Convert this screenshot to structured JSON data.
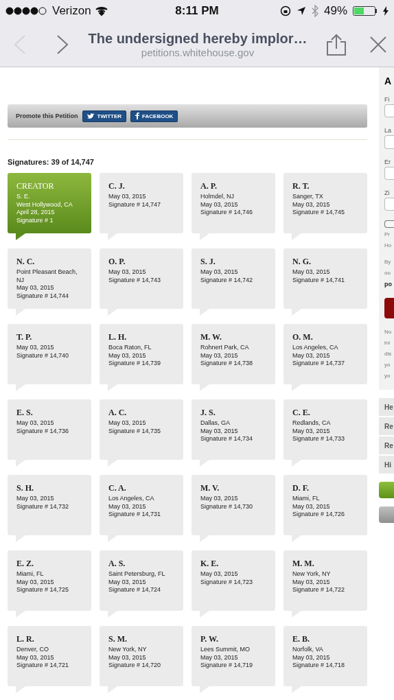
{
  "status_bar": {
    "carrier": "Verizon",
    "time": "8:11 PM",
    "battery": "49%"
  },
  "browser": {
    "title": "The undersigned hereby implor…",
    "url": "petitions.whitehouse.gov"
  },
  "promote": {
    "label": "Promote this Petition",
    "buttons": [
      "TWITTER",
      "FACEBOOK"
    ]
  },
  "signatures_count": "Signatures: 39 of 14,747",
  "cards": [
    {
      "kind": "creator",
      "label": "CREATOR",
      "lines": [
        "S. E.",
        "West Hollywood, CA",
        "April 28, 2015",
        "Signature # 1"
      ]
    },
    {
      "kind": "signer",
      "label": "C. J.",
      "lines": [
        "May 03, 2015",
        "Signature # 14,747"
      ]
    },
    {
      "kind": "signer",
      "label": "A. P.",
      "lines": [
        "Holmdel, NJ",
        "May 03, 2015",
        "Signature # 14,746"
      ]
    },
    {
      "kind": "signer",
      "label": "R. T.",
      "lines": [
        "Sanger, TX",
        "May 03, 2015",
        "Signature # 14,745"
      ]
    },
    {
      "kind": "signer",
      "label": "N. C.",
      "lines": [
        "Point Pleasant Beach, NJ",
        "May 03, 2015",
        "Signature # 14,744"
      ]
    },
    {
      "kind": "signer",
      "label": "O. P.",
      "lines": [
        "May 03, 2015",
        "Signature # 14,743"
      ]
    },
    {
      "kind": "signer",
      "label": "S. J.",
      "lines": [
        "May 03, 2015",
        "Signature # 14,742"
      ]
    },
    {
      "kind": "signer",
      "label": "N. G.",
      "lines": [
        "May 03, 2015",
        "Signature # 14,741"
      ]
    },
    {
      "kind": "signer",
      "label": "T. P.",
      "lines": [
        "May 03, 2015",
        "Signature # 14,740"
      ]
    },
    {
      "kind": "signer",
      "label": "L. H.",
      "lines": [
        "Boca Raton, FL",
        "May 03, 2015",
        "Signature # 14,739"
      ]
    },
    {
      "kind": "signer",
      "label": "M. W.",
      "lines": [
        "Rohnert Park, CA",
        "May 03, 2015",
        "Signature # 14,738"
      ]
    },
    {
      "kind": "signer",
      "label": "O. M.",
      "lines": [
        "Los Angeles, CA",
        "May 03, 2015",
        "Signature # 14,737"
      ]
    },
    {
      "kind": "signer",
      "label": "E. S.",
      "lines": [
        "May 03, 2015",
        "Signature # 14,736"
      ]
    },
    {
      "kind": "signer",
      "label": "A. C.",
      "lines": [
        "May 03, 2015",
        "Signature # 14,735"
      ]
    },
    {
      "kind": "signer",
      "label": "J. S.",
      "lines": [
        "Dallas, GA",
        "May 03, 2015",
        "Signature # 14,734"
      ]
    },
    {
      "kind": "signer",
      "label": "C. E.",
      "lines": [
        "Redlands, CA",
        "May 03, 2015",
        "Signature # 14,733"
      ]
    },
    {
      "kind": "signer",
      "label": "S. H.",
      "lines": [
        "May 03, 2015",
        "Signature # 14,732"
      ]
    },
    {
      "kind": "signer",
      "label": "C. A.",
      "lines": [
        "Los Angeles, CA",
        "May 03, 2015",
        "Signature # 14,731"
      ]
    },
    {
      "kind": "signer",
      "label": "M. V.",
      "lines": [
        "May 03, 2015",
        "Signature # 14,730"
      ]
    },
    {
      "kind": "signer",
      "label": "D. F.",
      "lines": [
        "Miami, FL",
        "May 03, 2015",
        "Signature # 14,726"
      ]
    },
    {
      "kind": "signer",
      "label": "E. Z.",
      "lines": [
        "Miami, FL",
        "May 03, 2015",
        "Signature # 14,725"
      ]
    },
    {
      "kind": "signer",
      "label": "A. S.",
      "lines": [
        "Saint Petersburg, FL",
        "May 03, 2015",
        "Signature # 14,724"
      ]
    },
    {
      "kind": "signer",
      "label": "K. E.",
      "lines": [
        "May 03, 2015",
        "Signature # 14,723"
      ]
    },
    {
      "kind": "signer",
      "label": "M. M.",
      "lines": [
        "New York, NY",
        "May 03, 2015",
        "Signature # 14,722"
      ]
    },
    {
      "kind": "signer",
      "label": "L. R.",
      "lines": [
        "Denver, CO",
        "May 03, 2015",
        "Signature # 14,721"
      ]
    },
    {
      "kind": "signer",
      "label": "S. M.",
      "lines": [
        "New York, NY",
        "May 03, 2015",
        "Signature # 14,720"
      ]
    },
    {
      "kind": "signer",
      "label": "P. W.",
      "lines": [
        "Lees Summit, MO",
        "May 03, 2015",
        "Signature # 14,719"
      ]
    },
    {
      "kind": "signer",
      "label": "E. B.",
      "lines": [
        "Norfolk, VA",
        "May 03, 2015",
        "Signature # 14,718"
      ]
    }
  ],
  "sidebar": {
    "heading": "A",
    "fields": [
      "Fi",
      "La",
      "Er",
      "Zi"
    ],
    "checkbox": {
      "checked": false
    },
    "note_lines": [
      "Pr",
      "Ho"
    ],
    "terms_lines": [
      "By",
      "ou"
    ],
    "terms_link": "po",
    "disclaimer_lines": [
      "No",
      "ini",
      "dis",
      "yo",
      "yo"
    ],
    "links": [
      "He",
      "Re",
      "Re",
      "Hi"
    ]
  }
}
